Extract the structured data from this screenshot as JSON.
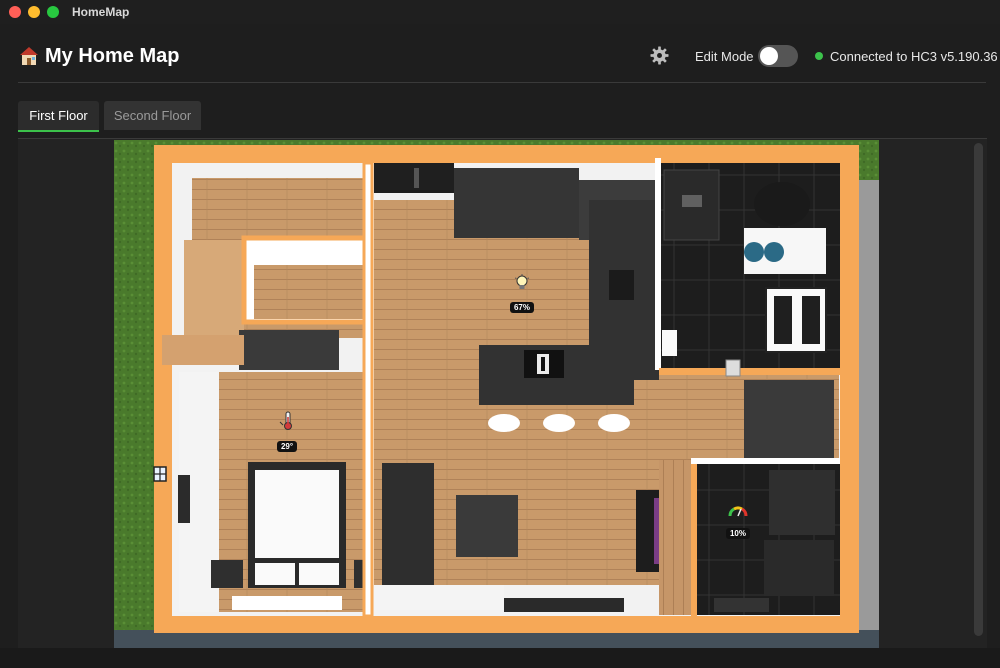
{
  "window": {
    "app_title": "HomeMap"
  },
  "header": {
    "house_icon": "house-emoji-icon",
    "title": "My Home Map",
    "settings_icon": "gear-icon",
    "edit_mode_label": "Edit Mode",
    "edit_mode_on": false,
    "connection_status": "Connected to HC3 v5.190.36",
    "connection_color": "#3cc24b"
  },
  "tabs": [
    {
      "label": "First Floor",
      "active": true
    },
    {
      "label": "Second Floor",
      "active": false
    }
  ],
  "devices": {
    "light": {
      "icon": "lightbulb-icon",
      "value": "67%"
    },
    "thermostat": {
      "icon": "thermometer-icon",
      "value": "29°"
    },
    "gauge": {
      "icon": "gauge-icon",
      "value": "10%"
    },
    "window_sensor": {
      "icon": "window-icon"
    }
  },
  "colors": {
    "accent": "#3cc24b",
    "room_highlight": "#f6a857",
    "floor_wood": "#c89a6b"
  }
}
